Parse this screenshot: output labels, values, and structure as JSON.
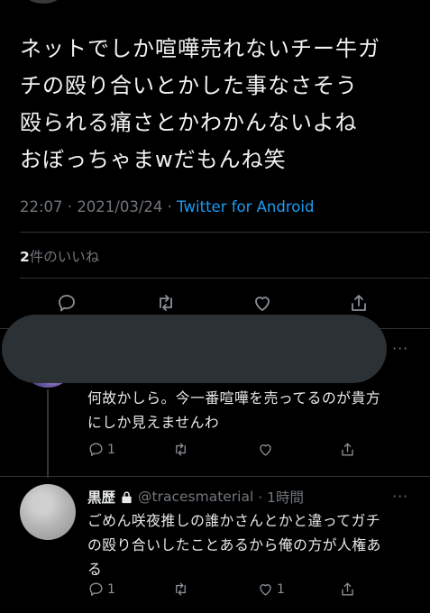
{
  "tweet": {
    "text": "ネットでしか喧嘩売れないチー牛ガ\nチの殴り合いとかした事なさそう\n殴られる痛さとかわかんないよね\nおぼっちゃまwだもんね笑",
    "time": "22:07",
    "date": "2021/03/24",
    "client": "Twitter for Android",
    "separator": " · ",
    "likes_count": "2",
    "likes_label": "件のいいね"
  },
  "reply1": {
    "text": "何故かしら。今一番喧嘩を売ってるのが貴方\nにしか見えませんわ",
    "reply_count": "1",
    "more": "···"
  },
  "reply2": {
    "name": "黒歴",
    "handle": "@tracesmaterial",
    "time": "· 1時間",
    "text": "ごめん咲夜推しの誰かさんとかと違ってガチ\nの殴り合いしたことあるから俺の方が人権あ\nる",
    "reply_count": "1",
    "like_count": "1",
    "more": "···"
  }
}
